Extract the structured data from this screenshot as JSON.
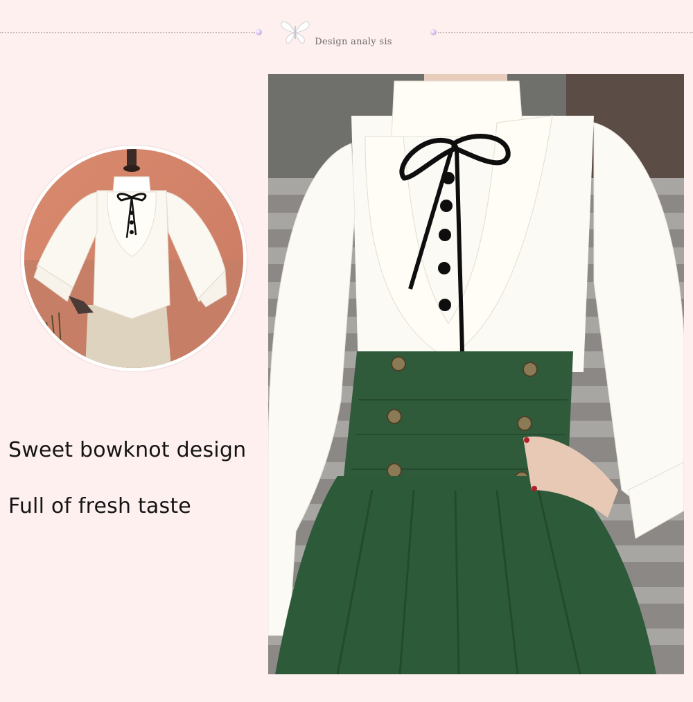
{
  "section": {
    "title": "Design analy sis",
    "ornament": "butterfly-icon"
  },
  "features": {
    "line1": "Sweet bowknot design",
    "line2": "Full of fresh taste"
  },
  "photos": {
    "detail": "mannequin-blouse-photo",
    "model": "model-blouse-skirt-photo"
  },
  "colors": {
    "background": "#fdf0ef",
    "text": "#141414"
  }
}
